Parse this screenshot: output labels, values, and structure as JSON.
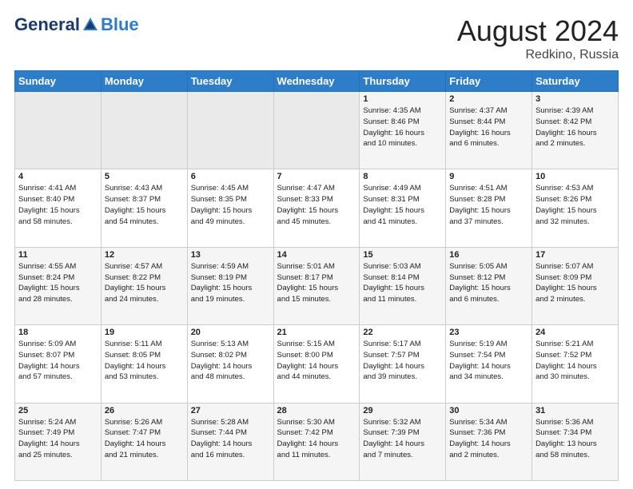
{
  "header": {
    "logo": {
      "general": "General",
      "blue": "Blue"
    },
    "title": "August 2024",
    "location": "Redkino, Russia"
  },
  "weekdays": [
    "Sunday",
    "Monday",
    "Tuesday",
    "Wednesday",
    "Thursday",
    "Friday",
    "Saturday"
  ],
  "weeks": [
    [
      {
        "day": "",
        "info": ""
      },
      {
        "day": "",
        "info": ""
      },
      {
        "day": "",
        "info": ""
      },
      {
        "day": "",
        "info": ""
      },
      {
        "day": "1",
        "info": "Sunrise: 4:35 AM\nSunset: 8:46 PM\nDaylight: 16 hours\nand 10 minutes."
      },
      {
        "day": "2",
        "info": "Sunrise: 4:37 AM\nSunset: 8:44 PM\nDaylight: 16 hours\nand 6 minutes."
      },
      {
        "day": "3",
        "info": "Sunrise: 4:39 AM\nSunset: 8:42 PM\nDaylight: 16 hours\nand 2 minutes."
      }
    ],
    [
      {
        "day": "4",
        "info": "Sunrise: 4:41 AM\nSunset: 8:40 PM\nDaylight: 15 hours\nand 58 minutes."
      },
      {
        "day": "5",
        "info": "Sunrise: 4:43 AM\nSunset: 8:37 PM\nDaylight: 15 hours\nand 54 minutes."
      },
      {
        "day": "6",
        "info": "Sunrise: 4:45 AM\nSunset: 8:35 PM\nDaylight: 15 hours\nand 49 minutes."
      },
      {
        "day": "7",
        "info": "Sunrise: 4:47 AM\nSunset: 8:33 PM\nDaylight: 15 hours\nand 45 minutes."
      },
      {
        "day": "8",
        "info": "Sunrise: 4:49 AM\nSunset: 8:31 PM\nDaylight: 15 hours\nand 41 minutes."
      },
      {
        "day": "9",
        "info": "Sunrise: 4:51 AM\nSunset: 8:28 PM\nDaylight: 15 hours\nand 37 minutes."
      },
      {
        "day": "10",
        "info": "Sunrise: 4:53 AM\nSunset: 8:26 PM\nDaylight: 15 hours\nand 32 minutes."
      }
    ],
    [
      {
        "day": "11",
        "info": "Sunrise: 4:55 AM\nSunset: 8:24 PM\nDaylight: 15 hours\nand 28 minutes."
      },
      {
        "day": "12",
        "info": "Sunrise: 4:57 AM\nSunset: 8:22 PM\nDaylight: 15 hours\nand 24 minutes."
      },
      {
        "day": "13",
        "info": "Sunrise: 4:59 AM\nSunset: 8:19 PM\nDaylight: 15 hours\nand 19 minutes."
      },
      {
        "day": "14",
        "info": "Sunrise: 5:01 AM\nSunset: 8:17 PM\nDaylight: 15 hours\nand 15 minutes."
      },
      {
        "day": "15",
        "info": "Sunrise: 5:03 AM\nSunset: 8:14 PM\nDaylight: 15 hours\nand 11 minutes."
      },
      {
        "day": "16",
        "info": "Sunrise: 5:05 AM\nSunset: 8:12 PM\nDaylight: 15 hours\nand 6 minutes."
      },
      {
        "day": "17",
        "info": "Sunrise: 5:07 AM\nSunset: 8:09 PM\nDaylight: 15 hours\nand 2 minutes."
      }
    ],
    [
      {
        "day": "18",
        "info": "Sunrise: 5:09 AM\nSunset: 8:07 PM\nDaylight: 14 hours\nand 57 minutes."
      },
      {
        "day": "19",
        "info": "Sunrise: 5:11 AM\nSunset: 8:05 PM\nDaylight: 14 hours\nand 53 minutes."
      },
      {
        "day": "20",
        "info": "Sunrise: 5:13 AM\nSunset: 8:02 PM\nDaylight: 14 hours\nand 48 minutes."
      },
      {
        "day": "21",
        "info": "Sunrise: 5:15 AM\nSunset: 8:00 PM\nDaylight: 14 hours\nand 44 minutes."
      },
      {
        "day": "22",
        "info": "Sunrise: 5:17 AM\nSunset: 7:57 PM\nDaylight: 14 hours\nand 39 minutes."
      },
      {
        "day": "23",
        "info": "Sunrise: 5:19 AM\nSunset: 7:54 PM\nDaylight: 14 hours\nand 34 minutes."
      },
      {
        "day": "24",
        "info": "Sunrise: 5:21 AM\nSunset: 7:52 PM\nDaylight: 14 hours\nand 30 minutes."
      }
    ],
    [
      {
        "day": "25",
        "info": "Sunrise: 5:24 AM\nSunset: 7:49 PM\nDaylight: 14 hours\nand 25 minutes."
      },
      {
        "day": "26",
        "info": "Sunrise: 5:26 AM\nSunset: 7:47 PM\nDaylight: 14 hours\nand 21 minutes."
      },
      {
        "day": "27",
        "info": "Sunrise: 5:28 AM\nSunset: 7:44 PM\nDaylight: 14 hours\nand 16 minutes."
      },
      {
        "day": "28",
        "info": "Sunrise: 5:30 AM\nSunset: 7:42 PM\nDaylight: 14 hours\nand 11 minutes."
      },
      {
        "day": "29",
        "info": "Sunrise: 5:32 AM\nSunset: 7:39 PM\nDaylight: 14 hours\nand 7 minutes."
      },
      {
        "day": "30",
        "info": "Sunrise: 5:34 AM\nSunset: 7:36 PM\nDaylight: 14 hours\nand 2 minutes."
      },
      {
        "day": "31",
        "info": "Sunrise: 5:36 AM\nSunset: 7:34 PM\nDaylight: 13 hours\nand 58 minutes."
      }
    ]
  ]
}
